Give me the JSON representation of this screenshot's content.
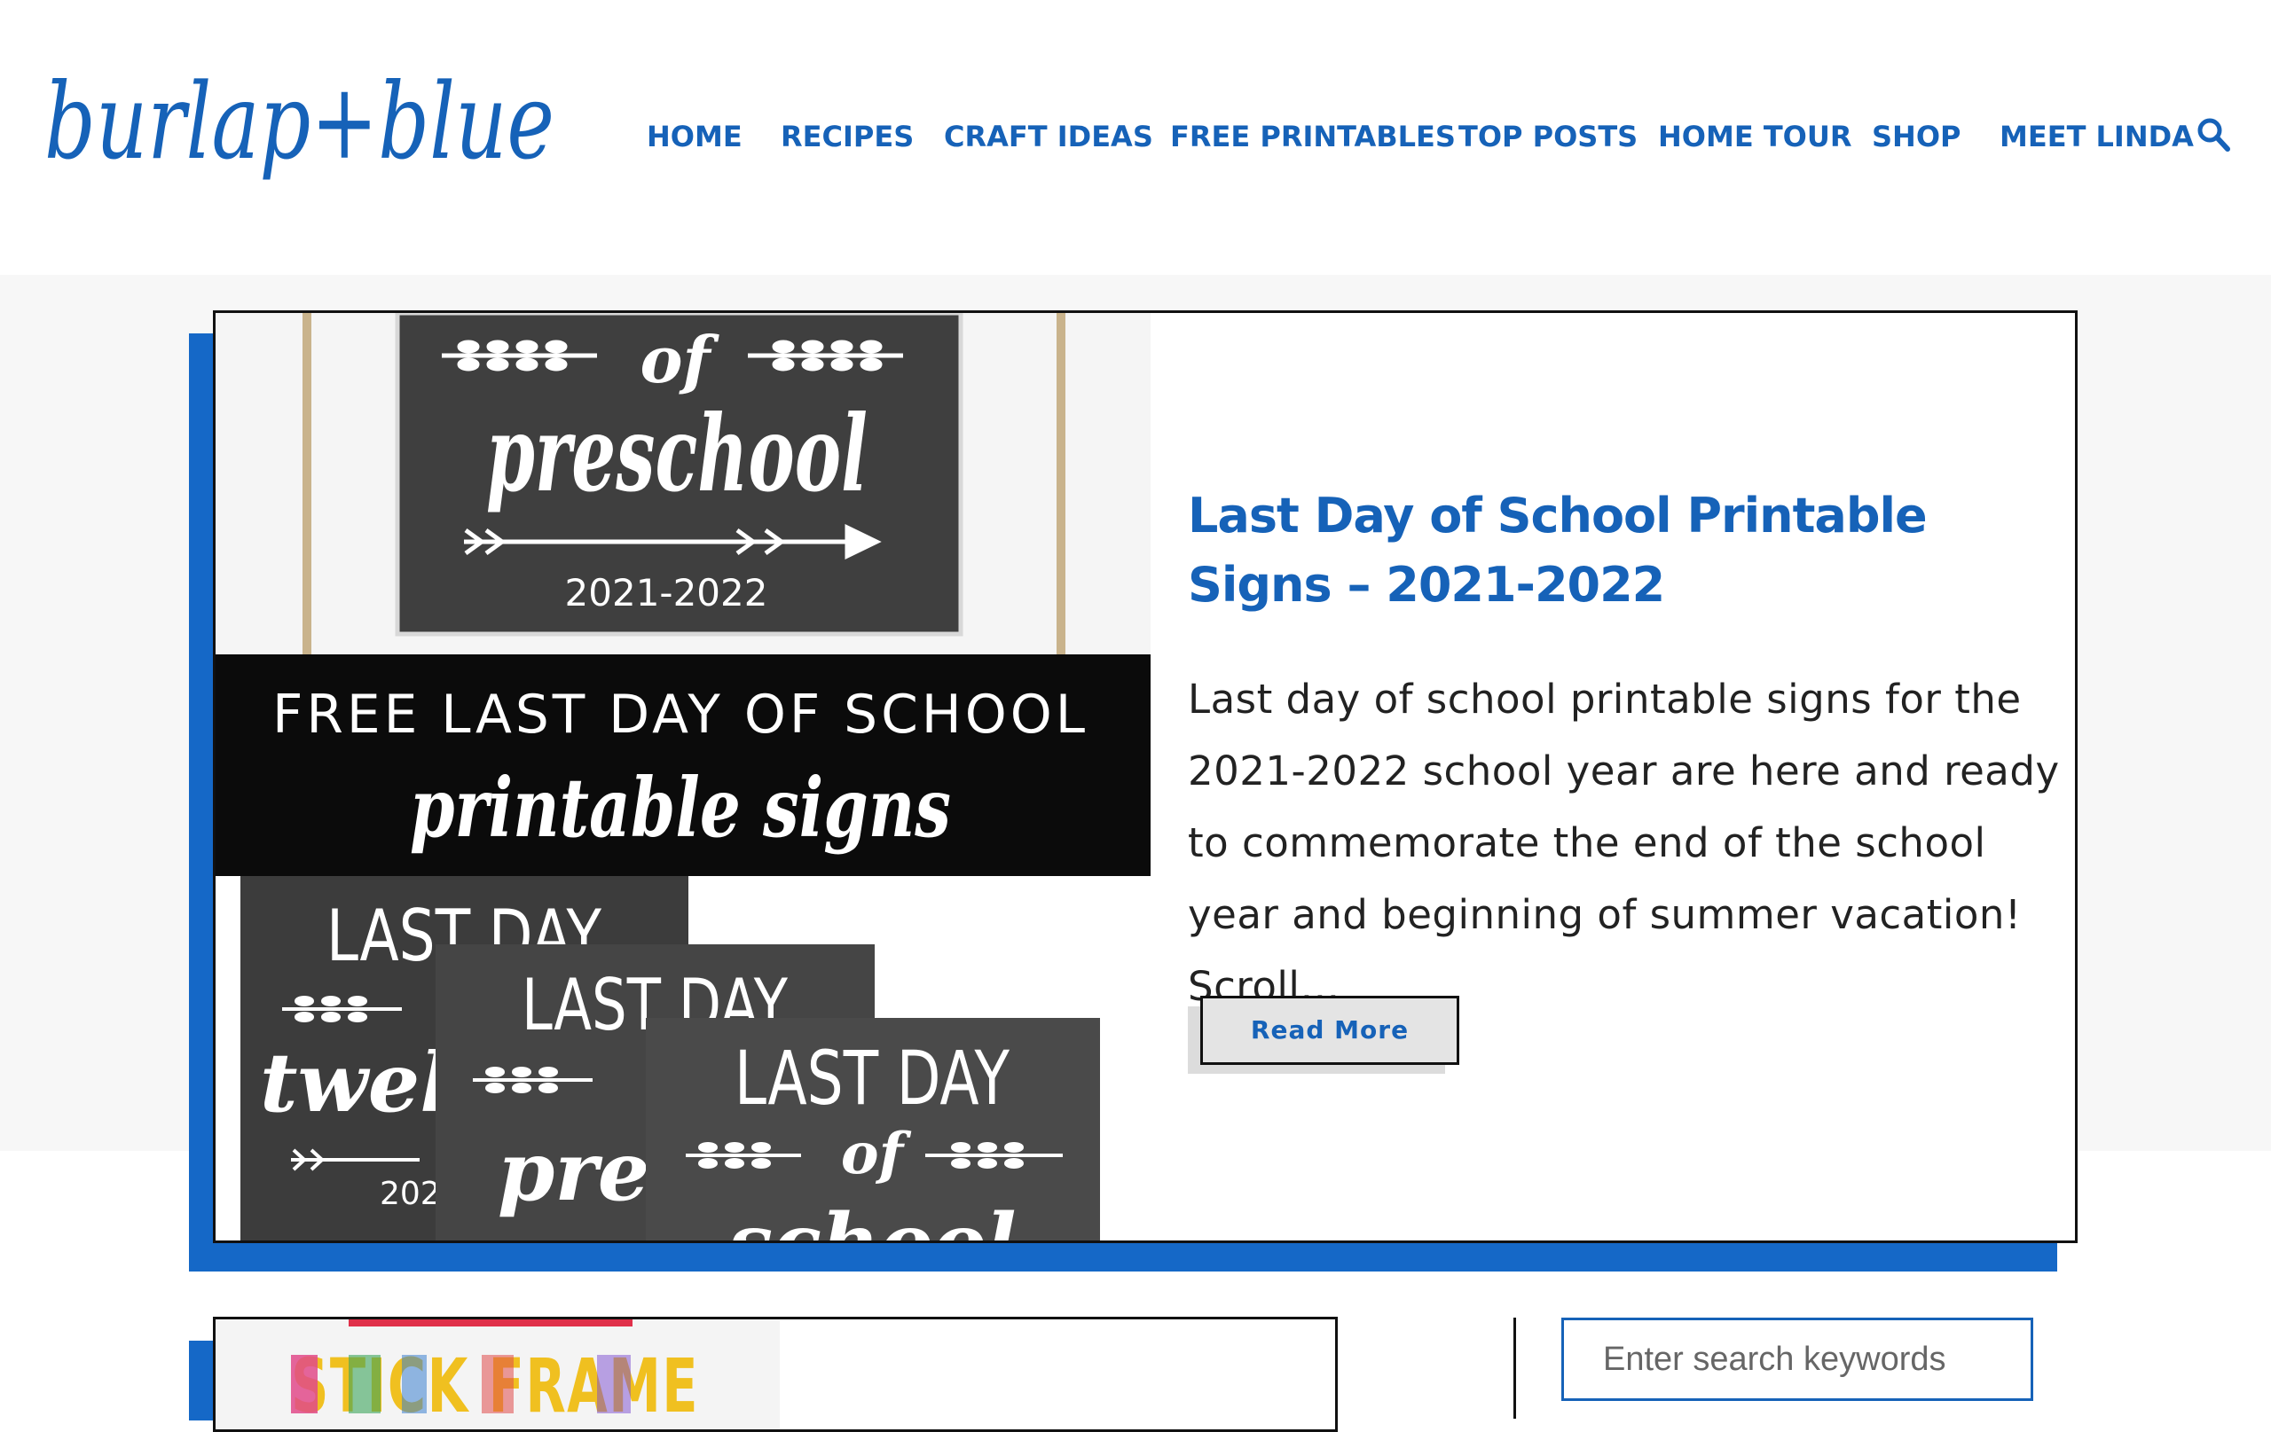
{
  "header": {
    "logo_text": "burlap+blue",
    "nav": [
      {
        "label": "HOME",
        "name": "nav-home"
      },
      {
        "label": "RECIPES",
        "name": "nav-recipes"
      },
      {
        "label": "CRAFT IDEAS",
        "name": "nav-craft-ideas"
      },
      {
        "label": "FREE PRINTABLES",
        "name": "nav-free-printables"
      },
      {
        "label": "TOP POSTS",
        "name": "nav-top-posts"
      },
      {
        "label": "HOME TOUR",
        "name": "nav-home-tour"
      },
      {
        "label": "SHOP",
        "name": "nav-shop"
      },
      {
        "label": "MEET LINDA",
        "name": "nav-meet-linda"
      }
    ],
    "search_icon": "search-icon"
  },
  "featured_post": {
    "title": "Last Day of School Printable Signs – 2021-2022",
    "excerpt": "Last day of school printable signs for the 2021-2022 school year are here and ready to commemorate the end of the school year and beginning of summer vacation! Scroll…",
    "read_more_label": "Read More",
    "image": {
      "top_sign_word1": "of",
      "top_sign_word2": "preschool",
      "top_sign_year": "2021-2022",
      "banner_line1": "FREE LAST DAY OF SCHOOL",
      "banner_line2": "printable signs",
      "sign1_line1": "LAST DAY",
      "sign1_word": "twelft",
      "sign1_year": "202",
      "sign2_line1": "LAST DAY",
      "sign2_word": "presc",
      "sign3_line1": "LAST DAY",
      "sign3_word1": "of",
      "sign3_word2": "school"
    }
  },
  "second_post": {
    "image_text": "STICK FRAME"
  },
  "sidebar": {
    "search_placeholder": "Enter search keywords"
  },
  "colors": {
    "brand_blue": "#1662b8",
    "accent_shadow": "#1568c7",
    "chalkboard": "#3f3f3f",
    "banner": "#0b0b0b"
  }
}
